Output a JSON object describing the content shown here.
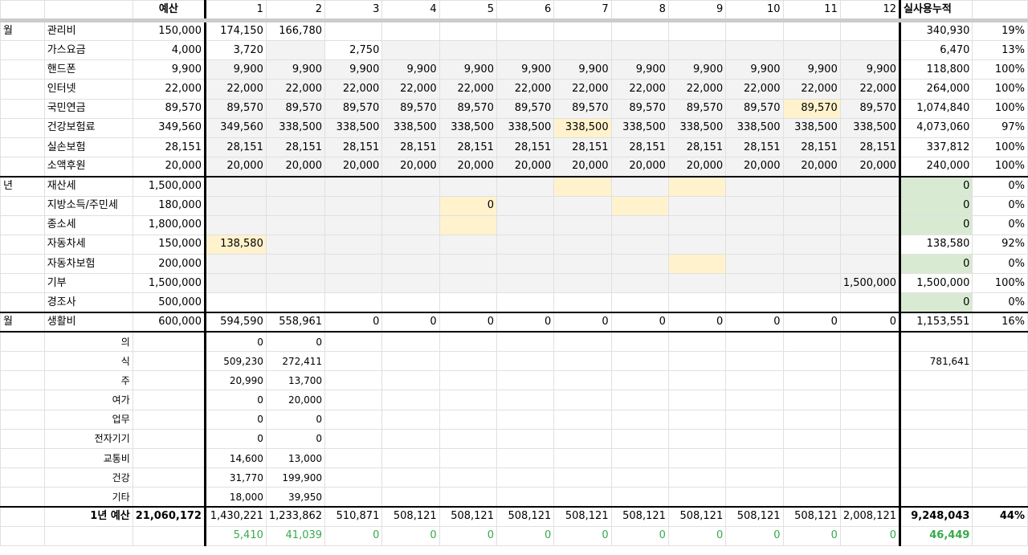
{
  "header": {
    "budget_label": "예산",
    "months": [
      "1",
      "2",
      "3",
      "4",
      "5",
      "6",
      "7",
      "8",
      "9",
      "10",
      "11",
      "12"
    ],
    "cumulative_label": "실사용누적"
  },
  "monthly_section_label": "월",
  "monthly_items": [
    {
      "name": "관리비",
      "budget": "150,000",
      "m": [
        "174,150",
        "166,780",
        "",
        "",
        "",
        "",
        "",
        "",
        "",
        "",
        "",
        ""
      ],
      "cum": "340,930",
      "pct": "19%"
    },
    {
      "name": "가스요금",
      "budget": "4,000",
      "m": [
        "3,720",
        "",
        "2,750",
        "",
        "",
        "",
        "",
        "",
        "",
        "",
        "",
        ""
      ],
      "cum": "6,470",
      "pct": "13%"
    },
    {
      "name": "핸드폰",
      "budget": "9,900",
      "m": [
        "9,900",
        "9,900",
        "9,900",
        "9,900",
        "9,900",
        "9,900",
        "9,900",
        "9,900",
        "9,900",
        "9,900",
        "9,900",
        "9,900"
      ],
      "cum": "118,800",
      "pct": "100%"
    },
    {
      "name": "인터넷",
      "budget": "22,000",
      "m": [
        "22,000",
        "22,000",
        "22,000",
        "22,000",
        "22,000",
        "22,000",
        "22,000",
        "22,000",
        "22,000",
        "22,000",
        "22,000",
        "22,000"
      ],
      "cum": "264,000",
      "pct": "100%"
    },
    {
      "name": "국민연금",
      "budget": "89,570",
      "m": [
        "89,570",
        "89,570",
        "89,570",
        "89,570",
        "89,570",
        "89,570",
        "89,570",
        "89,570",
        "89,570",
        "89,570",
        "89,570",
        "89,570"
      ],
      "cum": "1,074,840",
      "pct": "100%"
    },
    {
      "name": "건강보험료",
      "budget": "349,560",
      "m": [
        "349,560",
        "338,500",
        "338,500",
        "338,500",
        "338,500",
        "338,500",
        "338,500",
        "338,500",
        "338,500",
        "338,500",
        "338,500",
        "338,500"
      ],
      "cum": "4,073,060",
      "pct": "97%"
    },
    {
      "name": "실손보험",
      "budget": "28,151",
      "m": [
        "28,151",
        "28,151",
        "28,151",
        "28,151",
        "28,151",
        "28,151",
        "28,151",
        "28,151",
        "28,151",
        "28,151",
        "28,151",
        "28,151"
      ],
      "cum": "337,812",
      "pct": "100%"
    },
    {
      "name": "소액후원",
      "budget": "20,000",
      "m": [
        "20,000",
        "20,000",
        "20,000",
        "20,000",
        "20,000",
        "20,000",
        "20,000",
        "20,000",
        "20,000",
        "20,000",
        "20,000",
        "20,000"
      ],
      "cum": "240,000",
      "pct": "100%"
    }
  ],
  "yearly_section_label": "년",
  "yearly_items": [
    {
      "name": "재산세",
      "budget": "1,500,000",
      "m": [
        "",
        "",
        "",
        "",
        "",
        "",
        "",
        "",
        "",
        "",
        "",
        ""
      ],
      "cum": "0",
      "pct": "0%"
    },
    {
      "name": "지방소득/주민세",
      "budget": "180,000",
      "m": [
        "",
        "",
        "",
        "",
        "0",
        "",
        "",
        "",
        "",
        "",
        "",
        ""
      ],
      "cum": "0",
      "pct": "0%"
    },
    {
      "name": "종소세",
      "budget": "1,800,000",
      "m": [
        "",
        "",
        "",
        "",
        "",
        "",
        "",
        "",
        "",
        "",
        "",
        ""
      ],
      "cum": "0",
      "pct": "0%"
    },
    {
      "name": "자동차세",
      "budget": "150,000",
      "m": [
        "138,580",
        "",
        "",
        "",
        "",
        "",
        "",
        "",
        "",
        "",
        "",
        ""
      ],
      "cum": "138,580",
      "pct": "92%"
    },
    {
      "name": "자동차보험",
      "budget": "200,000",
      "m": [
        "",
        "",
        "",
        "",
        "",
        "",
        "",
        "",
        "",
        "",
        "",
        ""
      ],
      "cum": "0",
      "pct": "0%"
    },
    {
      "name": "기부",
      "budget": "1,500,000",
      "m": [
        "",
        "",
        "",
        "",
        "",
        "",
        "",
        "",
        "",
        "",
        "",
        "1,500,000"
      ],
      "cum": "1,500,000",
      "pct": "100%"
    },
    {
      "name": "경조사",
      "budget": "500,000",
      "m": [
        "",
        "",
        "",
        "",
        "",
        "",
        "",
        "",
        "",
        "",
        "",
        ""
      ],
      "cum": "0",
      "pct": "0%"
    }
  ],
  "living": {
    "section_label": "월",
    "name": "생활비",
    "budget": "600,000",
    "m": [
      "594,590",
      "558,961",
      "0",
      "0",
      "0",
      "0",
      "0",
      "0",
      "0",
      "0",
      "0",
      "0"
    ],
    "cum": "1,153,551",
    "pct": "16%"
  },
  "living_sub": [
    {
      "name": "의",
      "m1": "0",
      "m2": "0",
      "cum": ""
    },
    {
      "name": "식",
      "m1": "509,230",
      "m2": "272,411",
      "cum": "781,641"
    },
    {
      "name": "주",
      "m1": "20,990",
      "m2": "13,700",
      "cum": ""
    },
    {
      "name": "여가",
      "m1": "0",
      "m2": "20,000",
      "cum": ""
    },
    {
      "name": "업무",
      "m1": "0",
      "m2": "0",
      "cum": ""
    },
    {
      "name": "전자기기",
      "m1": "0",
      "m2": "0",
      "cum": ""
    },
    {
      "name": "교통비",
      "m1": "14,600",
      "m2": "13,000",
      "cum": ""
    },
    {
      "name": "건강",
      "m1": "31,770",
      "m2": "199,900",
      "cum": ""
    },
    {
      "name": "기타",
      "m1": "18,000",
      "m2": "39,950",
      "cum": ""
    }
  ],
  "total": {
    "label": "1년 예산",
    "budget": "21,060,172",
    "m": [
      "1,430,221",
      "1,233,862",
      "510,871",
      "508,121",
      "508,121",
      "508,121",
      "508,121",
      "508,121",
      "508,121",
      "508,121",
      "508,121",
      "2,008,121"
    ],
    "cum": "9,248,043",
    "pct": "44%"
  },
  "diff": {
    "m": [
      "5,410",
      "41,039",
      "0",
      "0",
      "0",
      "0",
      "0",
      "0",
      "0",
      "0",
      "0",
      "0"
    ],
    "cum": "46,449"
  },
  "colors": {
    "grey_cell": "#f3f3f3",
    "yellow_cell": "#fff2cc",
    "green_cell": "#d9ead3",
    "positive_text": "#38a94b"
  }
}
